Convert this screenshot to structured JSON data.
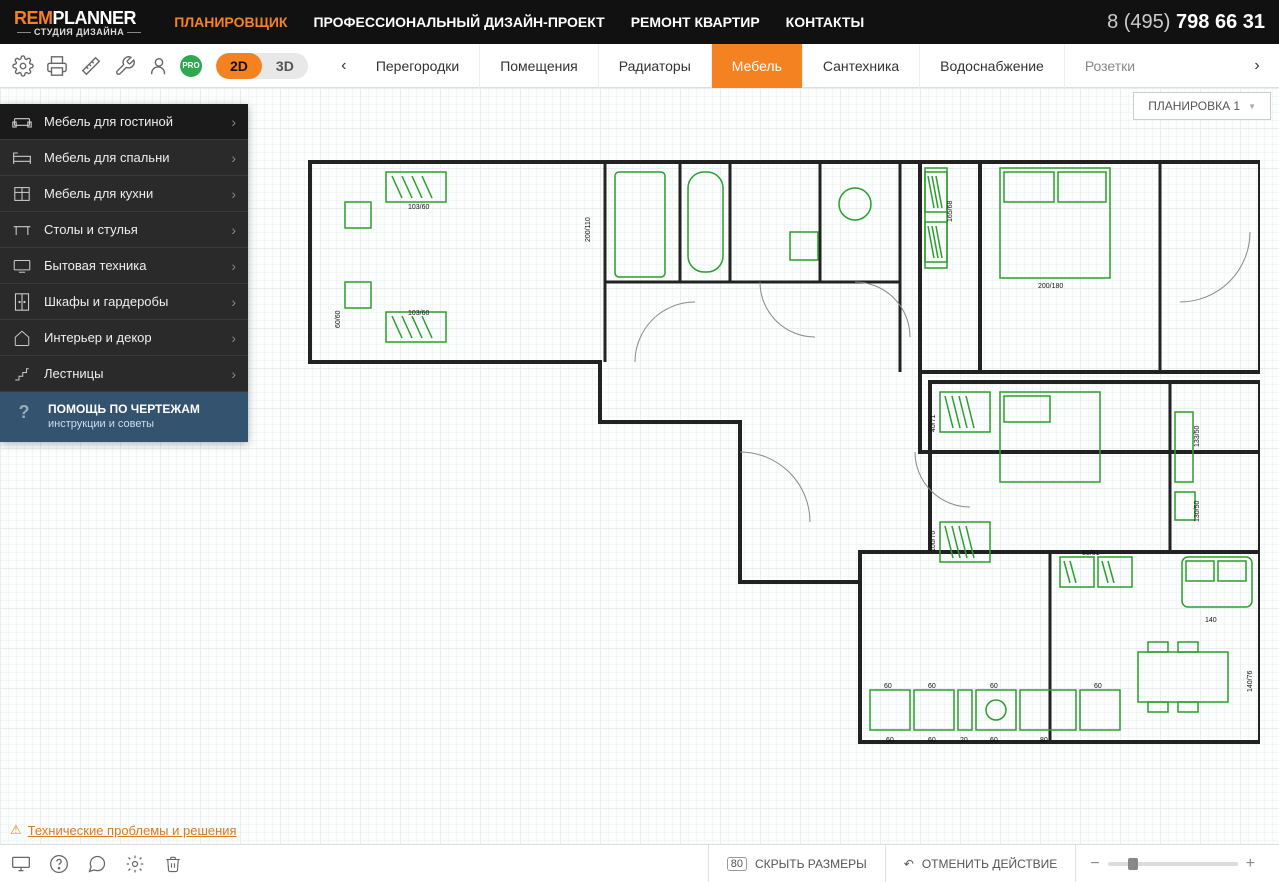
{
  "logo": {
    "prefix": "REM",
    "suffix": "PLANNER",
    "subtitle": "СТУДИЯ ДИЗАЙНА"
  },
  "nav": {
    "items": [
      {
        "label": "ПЛАНИРОВЩИК",
        "active": true
      },
      {
        "label": "ПРОФЕССИОНАЛЬНЫЙ ДИЗАЙН-ПРОЕКТ",
        "active": false
      },
      {
        "label": "РЕМОНТ КВАРТИР",
        "active": false
      },
      {
        "label": "КОНТАКТЫ",
        "active": false
      }
    ]
  },
  "phone": {
    "prefix": "8 (495) ",
    "main": "798 66 31"
  },
  "view_toggle": {
    "two_d": "2D",
    "three_d": "3D",
    "active": "2D"
  },
  "pro_badge": "PRO",
  "tabs": [
    {
      "label": "Перегородки",
      "active": false
    },
    {
      "label": "Помещения",
      "active": false
    },
    {
      "label": "Радиаторы",
      "active": false
    },
    {
      "label": "Мебель",
      "active": true
    },
    {
      "label": "Сантехника",
      "active": false
    },
    {
      "label": "Водоснабжение",
      "active": false
    },
    {
      "label": "Розетки",
      "active": false
    }
  ],
  "layout_picker": "ПЛАНИРОВКА 1",
  "sidebar": {
    "items": [
      {
        "label": "Мебель для гостиной"
      },
      {
        "label": "Мебель для спальни"
      },
      {
        "label": "Мебель для кухни"
      },
      {
        "label": "Столы и стулья"
      },
      {
        "label": "Бытовая техника"
      },
      {
        "label": "Шкафы и гардеробы"
      },
      {
        "label": "Интерьер и декор"
      },
      {
        "label": "Лестницы"
      }
    ],
    "help": {
      "title": "ПОМОЩЬ ПО ЧЕРТЕЖАМ",
      "subtitle": "инструкции и советы"
    }
  },
  "floorplan_labels": {
    "dim1": "103/60",
    "dim2": "103/60",
    "dim3": "200/110",
    "dim4": "60/60",
    "dim5": "165/68",
    "dim6": "200/180",
    "dim7": "40/71",
    "dim8": "133/50",
    "dim9": "100/70",
    "dim10": "130/50",
    "dim11": "88/61",
    "dim12": "140",
    "dim13": "140/76",
    "dim14": "60",
    "dim15": "60",
    "dim16": "60",
    "dim17": "60",
    "dim18": "60",
    "dim19": "60",
    "dim20": "20",
    "dim21": "60",
    "dim22": "80"
  },
  "issues_link": "Технические проблемы и решения",
  "footer": {
    "hide_sizes": "СКРЫТЬ РАЗМЕРЫ",
    "undo": "ОТМЕНИТЬ ДЕЙСТВИЕ"
  }
}
